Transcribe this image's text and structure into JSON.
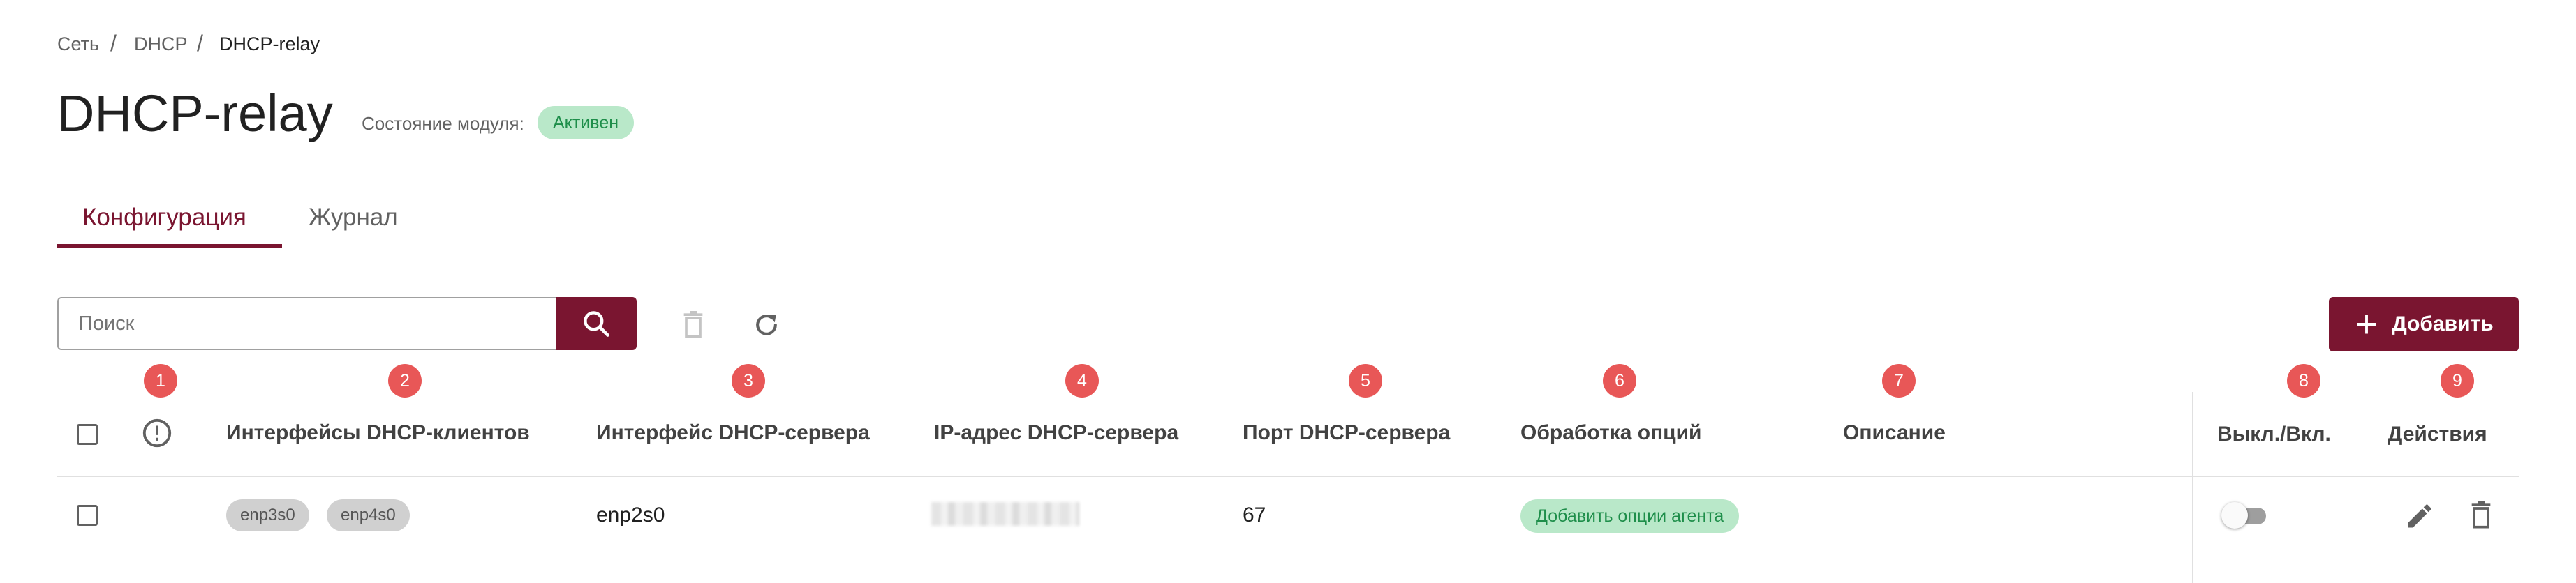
{
  "breadcrumb": {
    "items": [
      "Сеть",
      "DHCP",
      "DHCP-relay"
    ],
    "separator": "/"
  },
  "page": {
    "title": "DHCP-relay",
    "module_state_label": "Состояние модуля:",
    "module_state_value": "Активен"
  },
  "tabs": [
    {
      "label": "Конфигурация",
      "active": true
    },
    {
      "label": "Журнал",
      "active": false
    }
  ],
  "toolbar": {
    "search_placeholder": "Поиск",
    "search_icon": "search-icon",
    "delete_icon": "trash-icon",
    "refresh_icon": "refresh-icon",
    "add_label": "Добавить",
    "add_icon": "plus-icon"
  },
  "markers": [
    "1",
    "2",
    "3",
    "4",
    "5",
    "6",
    "7",
    "8",
    "9"
  ],
  "table": {
    "columns": [
      "Интерфейсы DHCP-клиентов",
      "Интерфейс DHCP-сервера",
      "IP-адрес DHCP-сервера",
      "Порт DHCP-сервера",
      "Обработка опций",
      "Описание",
      "Выкл./Вкл.",
      "Действия"
    ],
    "status_column_icon": "alert-circle-icon",
    "rows": [
      {
        "checked": false,
        "client_interfaces": [
          "enp3s0",
          "enp4s0"
        ],
        "server_interface": "enp2s0",
        "server_ip": "",
        "server_port": "67",
        "options_processing": "Добавить опции агента",
        "description": "",
        "enabled": false,
        "actions": [
          "pencil-icon",
          "trash-icon"
        ]
      }
    ]
  },
  "colors": {
    "accent": "#7a1530",
    "marker": "#e85757",
    "badge_bg": "#b9e8c9",
    "badge_text": "#1e8e4a",
    "chip_bg": "#d0d0d0"
  }
}
